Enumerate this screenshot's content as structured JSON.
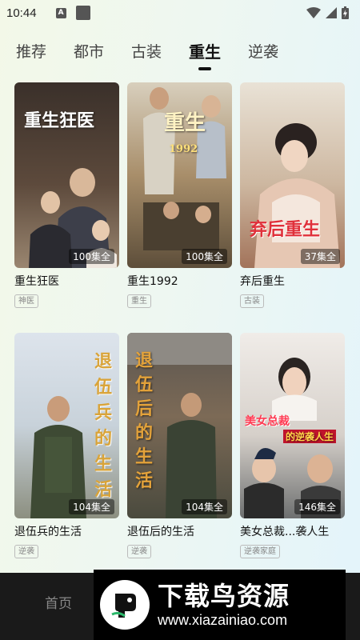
{
  "status_bar": {
    "time": "10:44",
    "notification_badge": "A"
  },
  "tabs": [
    {
      "label": "推荐",
      "active": false
    },
    {
      "label": "都市",
      "active": false
    },
    {
      "label": "古装",
      "active": false
    },
    {
      "label": "重生",
      "active": true
    },
    {
      "label": "逆袭",
      "active": false
    }
  ],
  "cards": [
    {
      "title": "重生狂医",
      "episodes": "100集全",
      "tag": "神医",
      "poster_text": "重生狂医",
      "palette": [
        "#2b2622",
        "#8a7560"
      ]
    },
    {
      "title": "重生1992",
      "episodes": "100集全",
      "tag": "重生",
      "poster_text": "重生",
      "poster_sub": "1992",
      "palette": [
        "#b9a27a",
        "#6e5a3c"
      ]
    },
    {
      "title": "弃后重生",
      "episodes": "37集全",
      "tag": "古装",
      "poster_text": "弃后重生",
      "palette": [
        "#d7c8b7",
        "#8f5a44"
      ]
    },
    {
      "title": "退伍兵的生活",
      "episodes": "104集全",
      "tag": "逆袭",
      "poster_text": "退伍兵的生活",
      "palette": [
        "#cdd7e3",
        "#3e4a34"
      ]
    },
    {
      "title": "退伍后的生活",
      "episodes": "104集全",
      "tag": "逆袭",
      "poster_text": "退伍后的生活",
      "palette": [
        "#7a6b5a",
        "#3a4334"
      ]
    },
    {
      "title": "美女总裁...袭人生",
      "episodes": "146集全",
      "tag": "逆袭家庭",
      "poster_text": "美女总裁",
      "poster_sub": "的逆袭人生",
      "palette": [
        "#e8e2dc",
        "#2a2a2a"
      ]
    }
  ],
  "bottom_nav": {
    "home_label": "首页"
  },
  "watermark": {
    "title": "下载鸟资源",
    "url": "www.xiazainiao.com"
  },
  "colors": {
    "episode_badge_bg": "#00000073",
    "nav_bg": "#1a1a1a",
    "tab_active": "#111111"
  }
}
